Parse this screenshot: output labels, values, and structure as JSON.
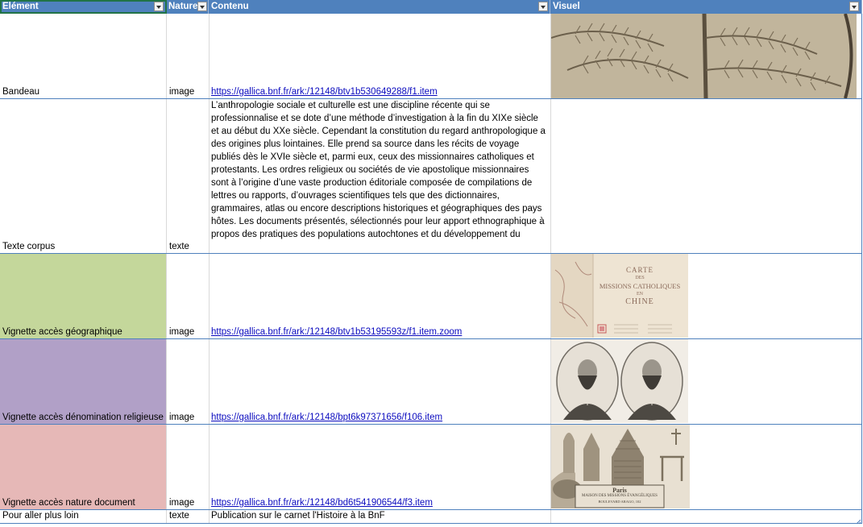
{
  "header": {
    "col_element": "Elément",
    "col_nature": "Nature",
    "col_contenu": "Contenu",
    "col_visuel": "Visuel"
  },
  "rows": [
    {
      "element": "Bandeau",
      "nature": "image",
      "contenu": "https://gallica.bnf.fr/ark:/12148/btv1b530649288/f1.item"
    },
    {
      "element": "Texte corpus",
      "nature": "texte",
      "contenu": "L’anthropologie sociale et culturelle est une discipline récente qui se professionnalise et se dote d’une méthode d’investigation à la fin du XIXe siècle et au début du XXe siècle. Cependant la constitution du regard anthropologique a des origines plus lointaines. Elle prend sa source dans les récits de voyage publiés dès le XVIe siècle et, parmi eux, ceux des missionnaires catholiques et protestants. Les ordres religieux ou sociétés de vie apostolique missionnaires sont à l’origine d’une vaste production éditoriale composée de compilations de lettres ou rapports, d’ouvrages scientifiques tels que des dictionnaires, grammaires, atlas ou encore descriptions historiques et géographiques des pays hôtes. Les documents présentés, sélectionnés pour leur apport ethnographique à propos des pratiques des populations autochtones et du développement du"
    },
    {
      "element": "Vignette accès géographique",
      "nature": "image",
      "contenu": "https://gallica.bnf.fr/ark:/12148/btv1b53195593z/f1.item.zoom"
    },
    {
      "element": "Vignette accès dénomination religieuse",
      "nature": "image",
      "contenu": "https://gallica.bnf.fr/ark:/12148/bpt6k97371656/f106.item"
    },
    {
      "element": "Vignette accès nature document",
      "nature": "image",
      "contenu": "https://gallica.bnf.fr/ark:/12148/bd6t541906544/f3.item"
    },
    {
      "element": "Pour aller plus loin",
      "nature": "texte",
      "contenu": "Publication sur le carnet l'Histoire à la BnF"
    }
  ],
  "thumbs": {
    "map_title_1": "CARTE",
    "map_title_2": "DES",
    "map_title_3": "MISSIONS CATHOLIQUES",
    "map_title_4": "EN",
    "map_title_5": "CHINE",
    "plate_title_1": "Paris",
    "plate_title_2": "MAISON DES MISSIONS ÉVANGÉLIQUES",
    "plate_title_3": "BOULEVARD ARAGO, 102"
  },
  "colors": {
    "header_bg": "#4f81bd",
    "geo_fill": "#c4d79b",
    "religion_fill": "#b1a0c7",
    "nature_fill": "#e6b8b7",
    "link": "#0b0bbf"
  }
}
